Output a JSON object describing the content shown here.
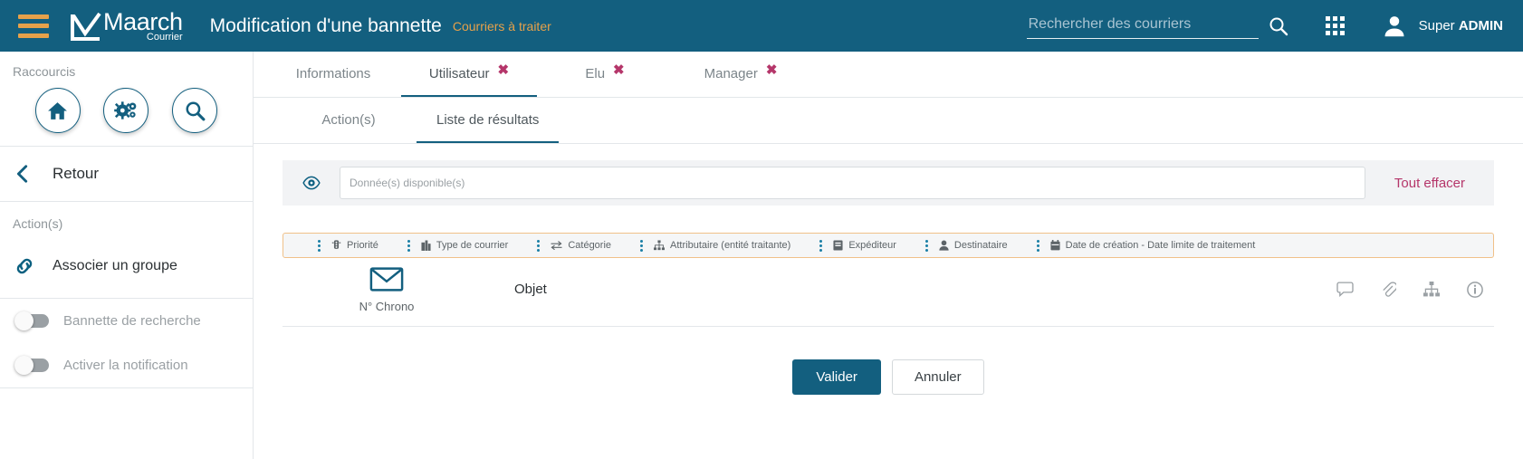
{
  "colors": {
    "brand": "#135f7f",
    "accent_orange": "#e6a14a",
    "accent_pink": "#b5366a",
    "muted": "#8e9599"
  },
  "header": {
    "menu_icon": "hamburger-menu-icon",
    "logo_main": "Maarch",
    "logo_sub": "Courrier",
    "title": "Modification d'une bannette",
    "subtitle": "Courriers à traiter",
    "search": {
      "placeholder": "Rechercher des courriers",
      "value": "",
      "icon": "search-icon"
    },
    "apps_icon": "grid-apps-icon",
    "user": {
      "avatar_icon": "user-avatar-icon",
      "first_name": "Super ",
      "last_name": "ADMIN"
    }
  },
  "sidebar": {
    "shortcuts_label": "Raccourcis",
    "shortcuts": [
      {
        "name": "home-icon",
        "label": "Accueil"
      },
      {
        "name": "gears-icon",
        "label": "Administration"
      },
      {
        "name": "search-icon",
        "label": "Recherche"
      }
    ],
    "back": {
      "label": "Retour",
      "icon": "chevron-left-icon"
    },
    "actions_label": "Action(s)",
    "actions": [
      {
        "label": "Associer un groupe",
        "icon": "link-icon"
      }
    ],
    "toggles": [
      {
        "label": "Bannette de recherche",
        "checked": false
      },
      {
        "label": "Activer la notification",
        "checked": false
      }
    ]
  },
  "main": {
    "tabs": [
      {
        "label": "Informations",
        "active": false,
        "closable": false
      },
      {
        "label": "Utilisateur",
        "active": true,
        "closable": true
      },
      {
        "label": "Elu",
        "active": false,
        "closable": true
      },
      {
        "label": "Manager",
        "active": false,
        "closable": true
      }
    ],
    "close_glyph": "✖",
    "subtabs": [
      {
        "label": "Action(s)",
        "active": false
      },
      {
        "label": "Liste de résultats",
        "active": true
      }
    ],
    "data_bar": {
      "eye_icon": "eye-icon",
      "input_placeholder": "Donnée(s) disponible(s)",
      "input_value": "",
      "clear_label": "Tout effacer"
    },
    "result_list": {
      "columns": [
        {
          "label": "Priorité",
          "icon": "traffic-light-icon"
        },
        {
          "label": "Type de courrier",
          "icon": "building-icon"
        },
        {
          "label": "Catégorie",
          "icon": "exchange-arrows-icon"
        },
        {
          "label": "Attributaire (entité traitante)",
          "icon": "sitemap-icon"
        },
        {
          "label": "Expéditeur",
          "icon": "book-icon"
        },
        {
          "label": "Destinataire",
          "icon": "user-icon"
        },
        {
          "label": "Date de création - Date limite de traitement",
          "icon": "calendar-icon"
        }
      ],
      "row": {
        "mail_icon": "envelope-icon",
        "chrono_label": "N° Chrono",
        "objet_label": "Objet",
        "action_icons": [
          "comment-icon",
          "attachment-icon",
          "sitemap-icon",
          "info-icon"
        ]
      }
    },
    "footer": {
      "validate_label": "Valider",
      "cancel_label": "Annuler"
    }
  }
}
